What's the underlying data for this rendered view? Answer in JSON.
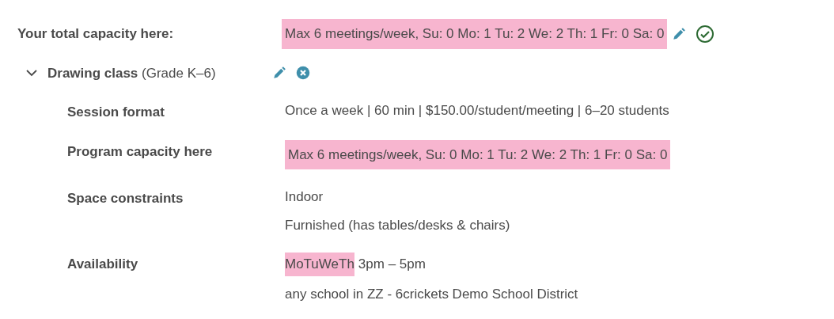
{
  "capacity": {
    "label": "Your total capacity here:",
    "parts": [
      {
        "text": "Max 6 meetings/week, Su: 0 Mo: 1 Tu: 2 We: 2 Th: 1 Fr: 0 Sa: 0",
        "highlighted": true
      }
    ]
  },
  "program": {
    "name": "Drawing class",
    "grade": "(Grade K–6)",
    "expanded": true,
    "details": [
      {
        "label": "Session format",
        "lines": [
          [
            {
              "text": "Once a week | 60 min | $150.00/student/meeting | 6–20 students",
              "highlighted": false
            }
          ]
        ]
      },
      {
        "label": "Program capacity here",
        "lines": [
          [
            {
              "text": "Max 6 meetings/week, Su: 0 Mo: 1 Tu: 2 We: 2 Th: 1 Fr: 0 Sa: 0",
              "highlighted": true
            }
          ]
        ]
      },
      {
        "label": "Space constraints",
        "lines": [
          [
            {
              "text": "Indoor",
              "highlighted": false
            }
          ],
          [
            {
              "text": "Furnished (has tables/desks & chairs)",
              "highlighted": false
            }
          ]
        ]
      },
      {
        "label": "Availability",
        "lines": [
          [
            {
              "text": "MoTuWeTh",
              "highlighted": true
            },
            {
              "text": "3pm – 5pm",
              "highlighted": false
            }
          ],
          [
            {
              "text": "any school in ZZ - 6crickets Demo School District",
              "highlighted": false
            }
          ]
        ]
      }
    ]
  }
}
